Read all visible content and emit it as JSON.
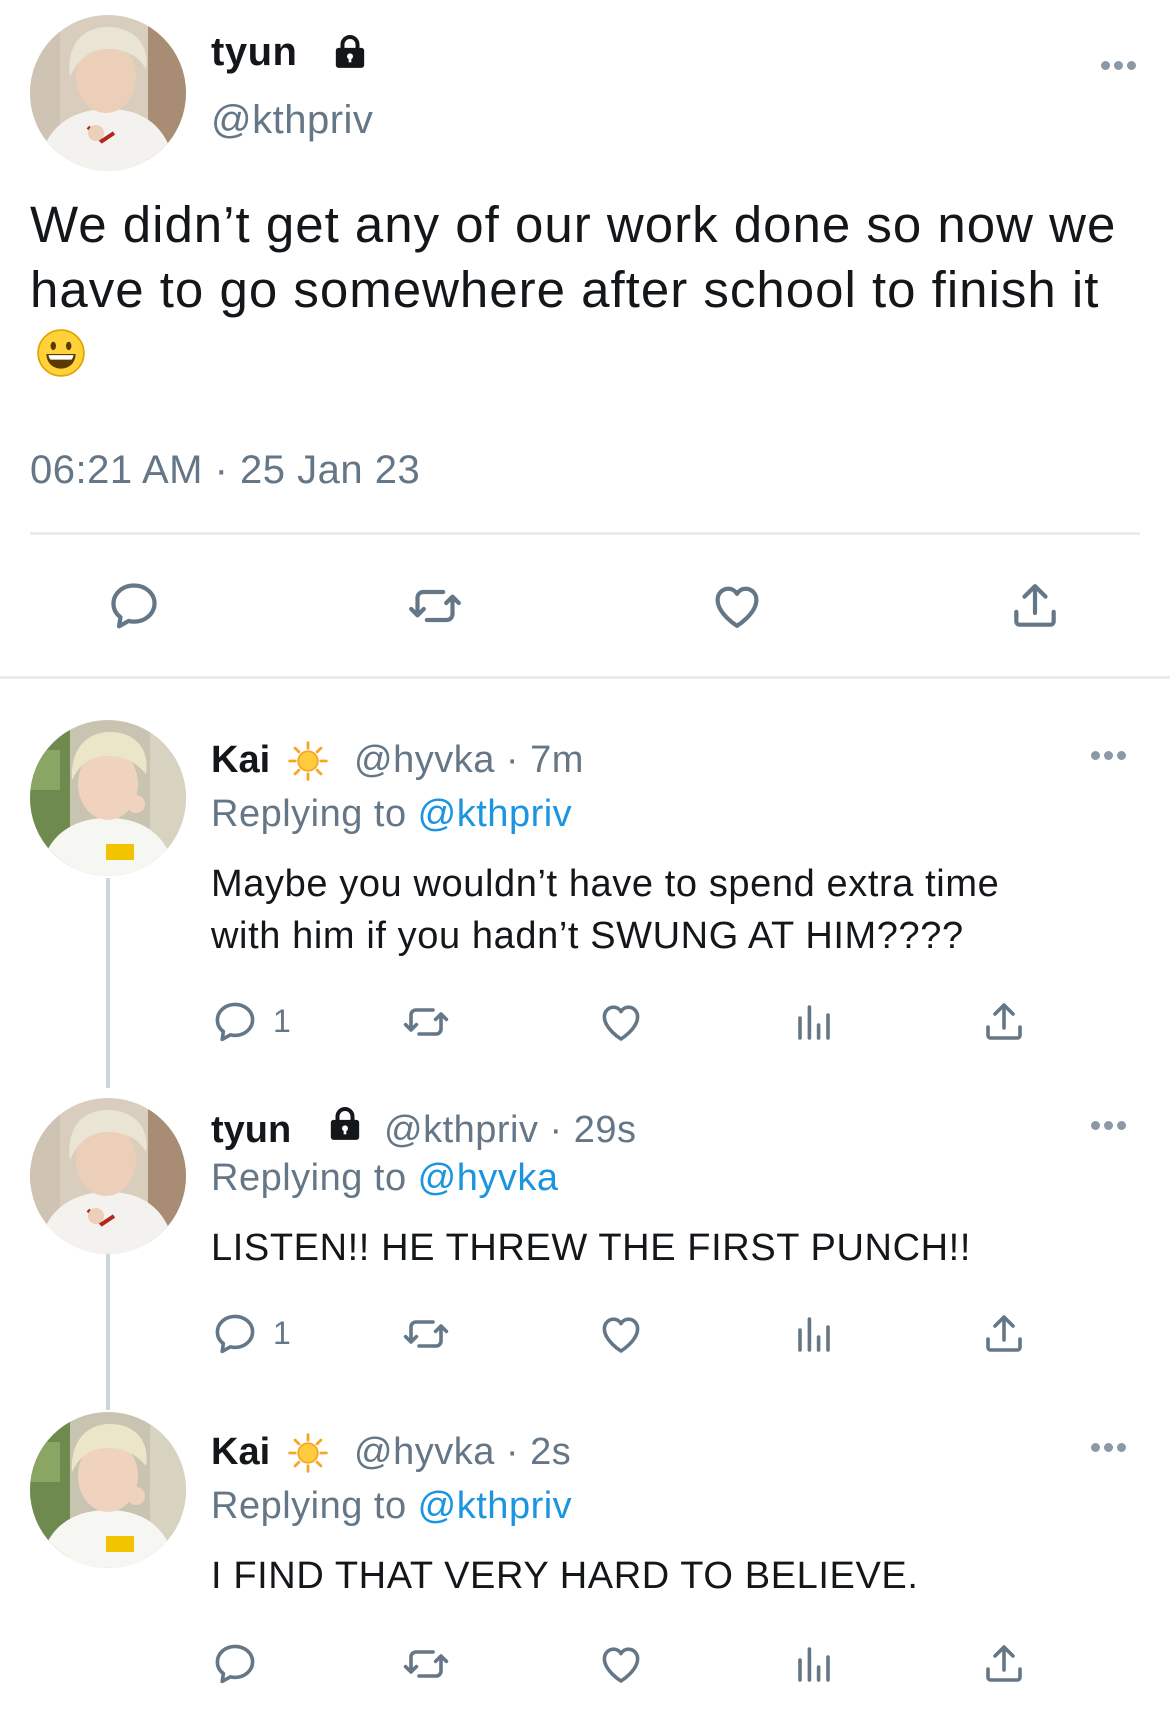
{
  "main_tweet": {
    "name": "tyun",
    "handle": "@kthpriv",
    "text": "We didn’t get any of our work done so now we have to go somewhere after school to finish it",
    "emoji": "smiley",
    "timestamp": "06:21 AM · 25 Jan 23",
    "actions": [
      "reply-icon",
      "retweet-icon",
      "like-icon",
      "share-icon"
    ]
  },
  "replies": [
    {
      "name": "Kai",
      "badge": "sun-icon",
      "meta": "@hyvka · 7m",
      "replying_prefix": "Replying to ",
      "replying_to": "@kthpriv",
      "text_lines": [
        "Maybe you wouldn’t have to spend extra time",
        "with him if you hadn’t SWUNG AT HIM????"
      ],
      "reply_count": "1"
    },
    {
      "name": "tyun",
      "badge": "lock-icon",
      "meta": "@kthpriv · 29s",
      "replying_prefix": "Replying to ",
      "replying_to": "@hyvka",
      "text_lines": [
        "LISTEN!! HE THREW THE FIRST PUNCH!!"
      ],
      "reply_count": "1"
    },
    {
      "name": "Kai",
      "badge": "sun-icon",
      "meta": "@hyvka · 2s",
      "replying_prefix": "Replying to ",
      "replying_to": "@kthpriv",
      "text_lines": [
        "I FIND THAT VERY HARD TO BELIEVE."
      ],
      "reply_count": ""
    }
  ],
  "colors": {
    "text": "#14171a",
    "secondary": "#657786",
    "link": "#1b95e0",
    "icon": "#657786",
    "divider": "#e6ecf0"
  }
}
